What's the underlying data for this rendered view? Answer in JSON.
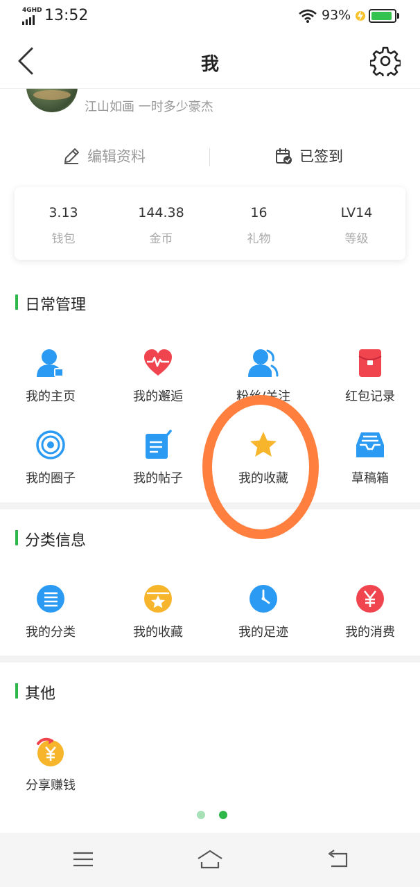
{
  "status_bar": {
    "network": "4GHD",
    "time": "13:52",
    "battery_percent": "93%",
    "battery_level": 0.93
  },
  "header": {
    "title": "我"
  },
  "profile": {
    "signature": "江山如画 一时多少豪杰",
    "edit_label": "编辑资料",
    "signin_label": "已签到"
  },
  "stats": [
    {
      "value": "3.13",
      "label": "钱包"
    },
    {
      "value": "144.38",
      "label": "金币"
    },
    {
      "value": "16",
      "label": "礼物"
    },
    {
      "value": "LV14",
      "label": "等级"
    }
  ],
  "sections": {
    "daily": {
      "title": "日常管理",
      "items": [
        {
          "label": "我的主页",
          "icon": "user-home-icon"
        },
        {
          "label": "我的邂逅",
          "icon": "heart-pulse-icon"
        },
        {
          "label": "粉丝/关注",
          "icon": "fans-icon"
        },
        {
          "label": "红包记录",
          "icon": "red-packet-icon"
        },
        {
          "label": "我的圈子",
          "icon": "circle-target-icon"
        },
        {
          "label": "我的帖子",
          "icon": "post-edit-icon"
        },
        {
          "label": "我的收藏",
          "icon": "star-icon"
        },
        {
          "label": "草稿箱",
          "icon": "inbox-icon"
        }
      ]
    },
    "category": {
      "title": "分类信息",
      "items": [
        {
          "label": "我的分类",
          "icon": "list-icon"
        },
        {
          "label": "我的收藏",
          "icon": "star-folder-icon"
        },
        {
          "label": "我的足迹",
          "icon": "clock-icon"
        },
        {
          "label": "我的消费",
          "icon": "yuan-icon"
        }
      ]
    },
    "other": {
      "title": "其他",
      "items": [
        {
          "label": "分享赚钱",
          "icon": "share-money-icon"
        }
      ]
    }
  },
  "pager": {
    "count": 2,
    "active_index": 1
  },
  "colors": {
    "accent_green": "#2fb84a",
    "highlight_orange": "#ff7f3f",
    "icon_blue": "#2b9af3",
    "icon_red": "#f0454f",
    "icon_yellow": "#f7b52c"
  }
}
